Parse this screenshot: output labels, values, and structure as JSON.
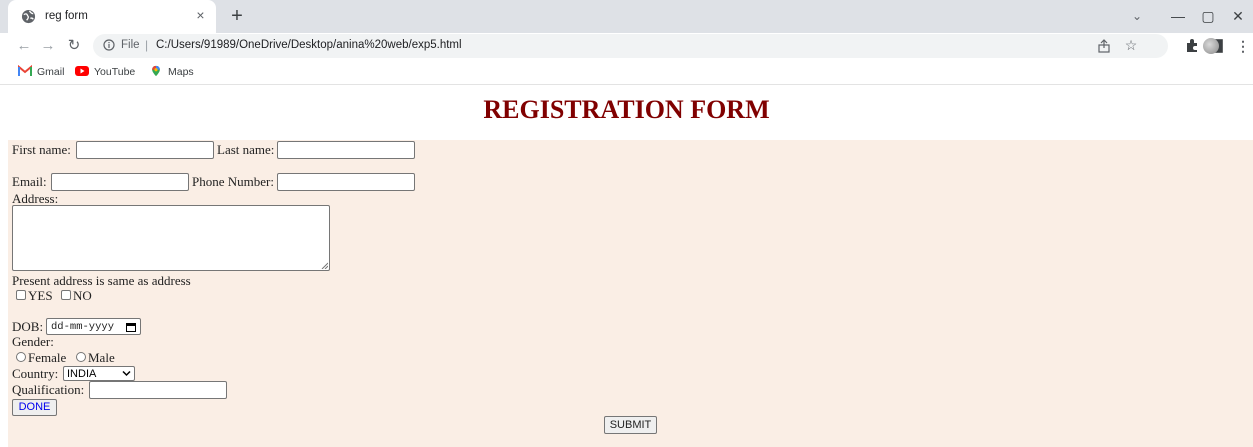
{
  "browser": {
    "tab_title": "reg form",
    "tab_close": "×",
    "new_tab": "+",
    "url_scheme": "File",
    "url_separator": "|",
    "url": "C:/Users/91989/OneDrive/Desktop/anina%20web/exp5.html",
    "window_controls": {
      "dropdown": "⌄",
      "minimize": "—",
      "maximize": "▢",
      "close": "✕"
    },
    "menu": "⋮",
    "bookmarks": [
      {
        "label": "Gmail",
        "icon": "gmail-icon"
      },
      {
        "label": "YouTube",
        "icon": "youtube-icon"
      },
      {
        "label": "Maps",
        "icon": "maps-icon"
      }
    ]
  },
  "page": {
    "title": "REGISTRATION FORM",
    "title_color": "#800000",
    "background_color": "#faeee5",
    "fields": {
      "first_name_label": "First name:",
      "first_name_value": "",
      "last_name_label": "Last name:",
      "last_name_value": "",
      "email_label": "Email:",
      "email_value": "",
      "phone_label": "Phone Number:",
      "phone_value": "",
      "address_label": "Address:",
      "address_value": "",
      "present_address_label": "Present address is same as address",
      "yes_label": "YES",
      "no_label": "NO",
      "dob_label": "DOB:",
      "dob_placeholder": "dd-mm-yyyy",
      "gender_label": "Gender:",
      "female_label": "Female",
      "male_label": "Male",
      "country_label": "Country:",
      "country_selected": "INDIA",
      "qualification_label": "Qualification:",
      "qualification_value": ""
    },
    "buttons": {
      "done": "DONE",
      "done_color": "#0000ee",
      "submit": "SUBMIT"
    }
  }
}
